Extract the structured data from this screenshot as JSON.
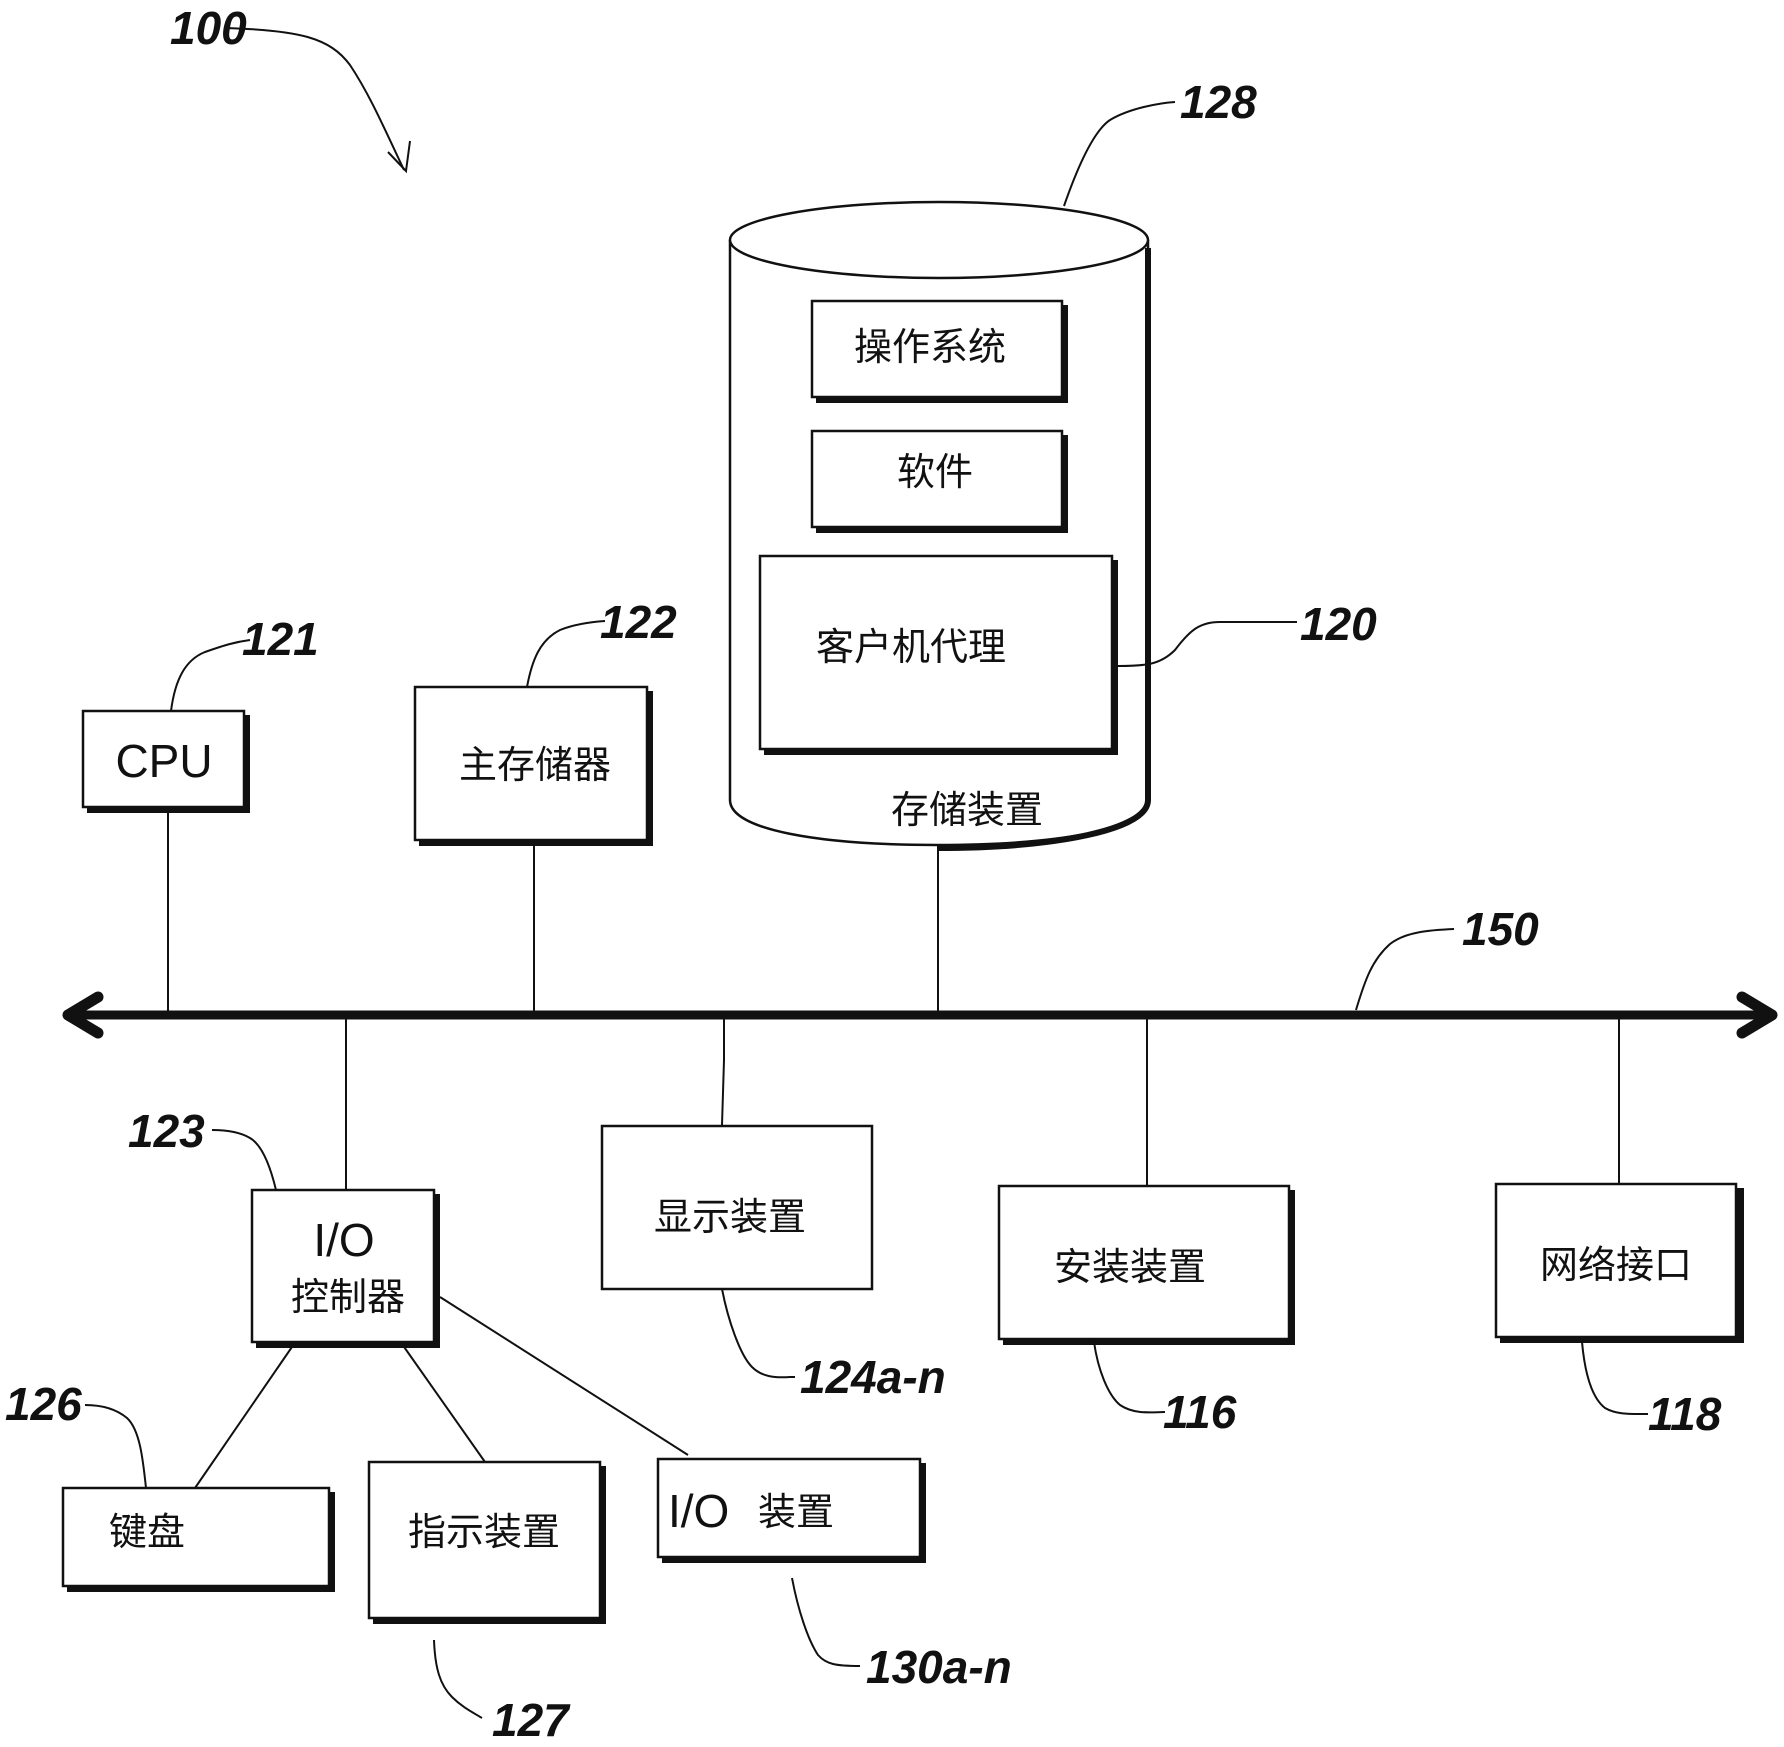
{
  "figure": {
    "ref": "100"
  },
  "bus": {
    "ref": "150"
  },
  "storage": {
    "ref": "128",
    "label": "存储装置",
    "modules": {
      "os": {
        "label": "操作系统"
      },
      "software": {
        "label": "软件"
      },
      "client_agent": {
        "label": "客户机代理",
        "ref": "120"
      }
    }
  },
  "components": {
    "cpu": {
      "label": "CPU",
      "ref": "121"
    },
    "main_memory": {
      "label": "主存储器",
      "ref": "122"
    },
    "io_controller": {
      "label_line1": "I/O",
      "label_line2": "控制器",
      "ref": "123"
    },
    "display": {
      "label": "显示装置",
      "ref": "124a-n"
    },
    "install_device": {
      "label": "安装装置",
      "ref": "116"
    },
    "network_interface": {
      "label": "网络接口",
      "ref": "118"
    },
    "keyboard": {
      "label": "键盘",
      "ref": "126"
    },
    "pointing_device": {
      "label": "指示装置",
      "ref": "127"
    },
    "io_device": {
      "label_prefix": "I/O",
      "label_suffix": "装置",
      "ref": "130a-n"
    }
  }
}
